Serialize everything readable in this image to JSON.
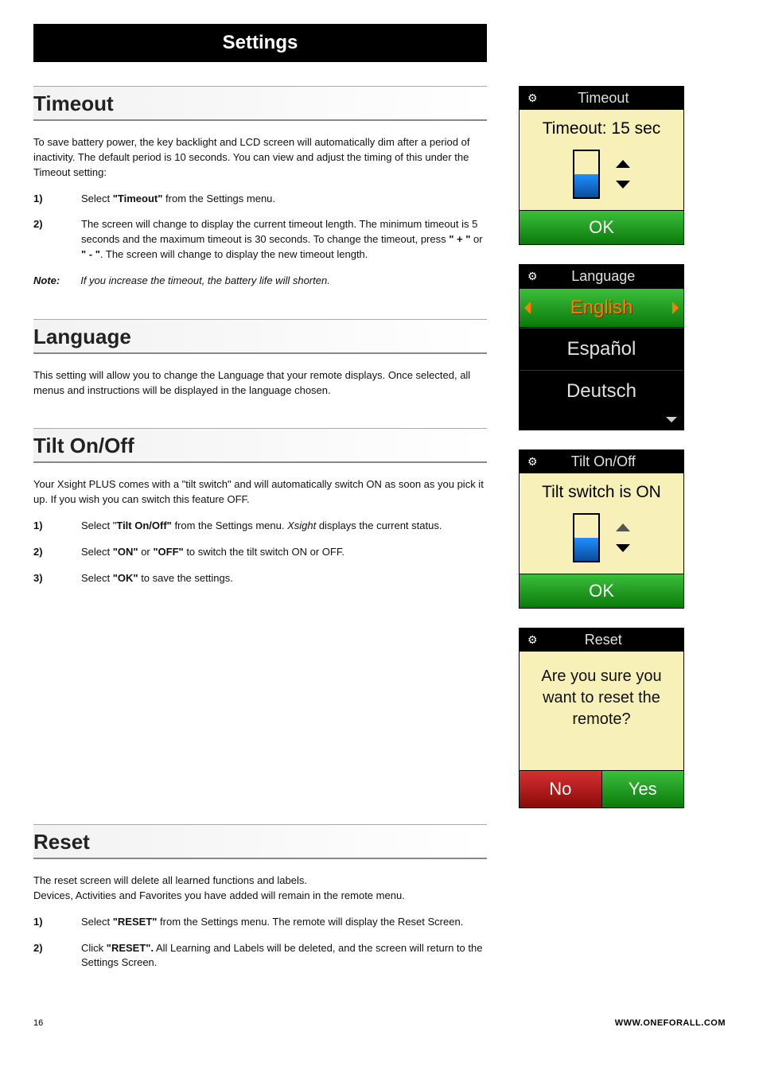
{
  "page_title": "Settings",
  "sections": {
    "timeout": {
      "heading": "Timeout",
      "intro": "To save battery power, the key backlight and LCD screen will automatically dim after a period of inactivity. The default period is 10 seconds. You can view and adjust the timing of this under the Timeout setting:",
      "steps": [
        {
          "n": "1)",
          "pre": "Select ",
          "bold": "\"Timeout\"",
          "post": " from the Settings menu."
        },
        {
          "n": "2)",
          "pre": "The screen will change to display the current timeout length. The minimum timeout is 5 seconds and the maximum timeout is 30 seconds. To change the timeout, press ",
          "bold": "\" + \"",
          "mid": " or ",
          "bold2": "\" - \"",
          "post": ". The screen will change to display the new timeout length."
        }
      ],
      "note_label": "Note:",
      "note_text": "If you increase the timeout, the battery life will shorten."
    },
    "language": {
      "heading": "Language",
      "intro": "This setting will allow you to change the Language that your remote displays. Once selected, all menus and instructions will be displayed in the language chosen."
    },
    "tilt": {
      "heading": "Tilt On/Off",
      "intro": "Your Xsight PLUS comes with a \"tilt switch\" and will automatically switch ON as soon as you pick it up. If you wish you can switch this feature OFF.",
      "steps": [
        {
          "n": "1)",
          "pre": "Select \"",
          "bold": "Tilt On/Off\"",
          "mid": " from the Settings menu. ",
          "ital": "Xsight",
          "post": " displays the current status."
        },
        {
          "n": "2)",
          "pre": "Select ",
          "bold": "\"ON\"",
          "mid": " or ",
          "bold2": "\"OFF\"",
          "post": " to switch the tilt switch ON or OFF."
        },
        {
          "n": "3)",
          "pre": "Select ",
          "bold": "\"OK\"",
          "post": " to save the settings."
        }
      ]
    },
    "reset": {
      "heading": "Reset",
      "intro1": "The reset screen will delete all learned functions and labels.",
      "intro2": "Devices, Activities and Favorites you have added will remain in the remote menu.",
      "steps": [
        {
          "n": "1)",
          "pre": "Select ",
          "bold": "\"RESET\"",
          "post": " from the Settings menu. The remote will display the Reset Screen."
        },
        {
          "n": "2)",
          "pre": "Click ",
          "bold": "\"RESET\".",
          "post": " All Learning and Labels will be deleted, and the screen will return to the Settings Screen."
        }
      ]
    }
  },
  "devices": {
    "timeout": {
      "header": "Timeout",
      "body": "Timeout: 15 sec",
      "ok": "OK",
      "fill_pct": 50
    },
    "language": {
      "header": "Language",
      "selected": "English",
      "options": [
        "Español",
        "Deutsch"
      ]
    },
    "tilt": {
      "header": "Tilt On/Off",
      "body": "Tilt switch is ON",
      "ok": "OK",
      "fill_pct": 50
    },
    "reset": {
      "header": "Reset",
      "body": "Are you sure you want to reset the remote?",
      "no": "No",
      "yes": "Yes"
    }
  },
  "footer": {
    "page": "16",
    "url": "WWW.ONEFORALL.COM"
  }
}
